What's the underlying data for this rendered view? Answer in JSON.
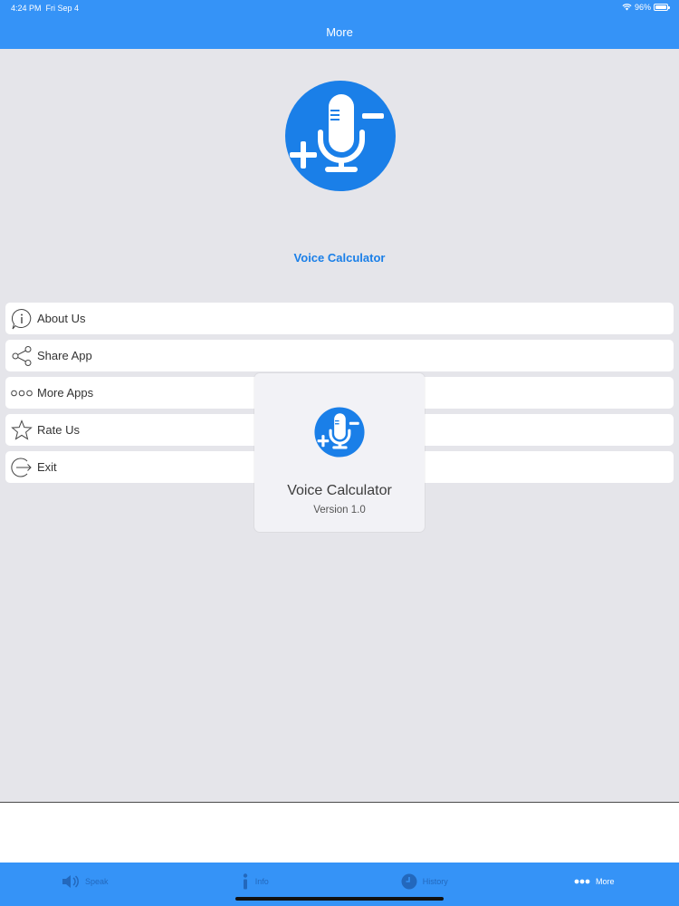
{
  "status_bar": {
    "time": "4:24 PM",
    "date": "Fri Sep 4",
    "battery": "96%",
    "battery_level": 0.96
  },
  "nav": {
    "title": "More"
  },
  "app": {
    "name": "Voice Calculator"
  },
  "menu": {
    "items": [
      {
        "label": "About Us",
        "icon": "info-icon"
      },
      {
        "label": "Share App",
        "icon": "share-icon"
      },
      {
        "label": "More Apps",
        "icon": "more-dots-icon"
      },
      {
        "label": "Rate Us",
        "icon": "star-icon"
      },
      {
        "label": "Exit",
        "icon": "exit-icon"
      }
    ]
  },
  "popup": {
    "title": "Voice Calculator",
    "version": "Version 1.0"
  },
  "tabs": [
    {
      "label": "Speak",
      "icon": "speaker-icon",
      "active": false
    },
    {
      "label": "Info",
      "icon": "info-icon",
      "active": false
    },
    {
      "label": "History",
      "icon": "clock-icon",
      "active": false
    },
    {
      "label": "More",
      "icon": "more-dots-icon",
      "active": true
    }
  ],
  "colors": {
    "primary": "#3593f7",
    "accent_text": "#1a7fe8",
    "logo_blue": "#1a7fe8",
    "background": "#e5e5ea"
  }
}
